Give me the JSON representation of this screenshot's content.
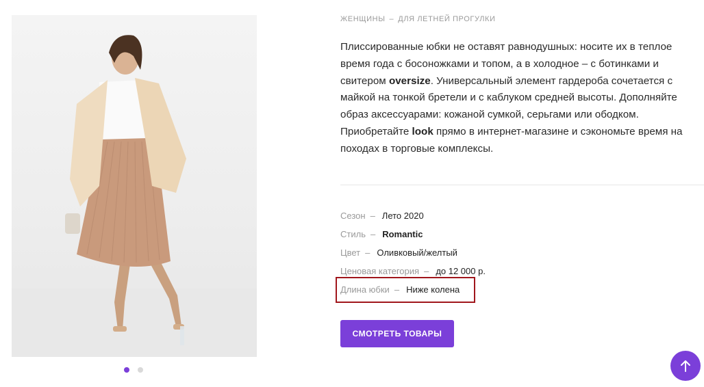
{
  "breadcrumb": {
    "items": [
      "ЖЕНЩИНЫ",
      "ДЛЯ ЛЕТНЕЙ ПРОГУЛКИ"
    ],
    "separator": "–"
  },
  "description": {
    "p1": "Плиссированные юбки не оставят равнодушных: носите их в теплое время года с босоножками и топом, а в холодное – с ботинками и свитером ",
    "b1": "oversize",
    "p2": ". Универсальный элемент гардероба сочетается с майкой на тонкой бретели и с каблуком средней высоты. Дополняйте образ аксессуарами: кожаной сумкой, серьгами или ободком. Приобретайте ",
    "b2": "look",
    "p3": " прямо в интернет-магазине и сэкономьте время на походах в торговые комплексы."
  },
  "attributes": [
    {
      "label": "Сезон",
      "value": "Лето 2020"
    },
    {
      "label": "Стиль",
      "value": "Romantic"
    },
    {
      "label": "Цвет",
      "value": "Оливковый/желтый"
    },
    {
      "label": "Ценовая категория",
      "value": "до 12 000 р."
    },
    {
      "label": "Длина юбки",
      "value": "Ниже колена"
    }
  ],
  "dash": "–",
  "cta": {
    "label": "СМОТРЕТЬ ТОВАРЫ"
  },
  "gallery": {
    "slides": 2,
    "active_index": 0
  },
  "colors": {
    "accent": "#7b3fd9",
    "highlight": "#a0151b"
  },
  "icons": {
    "scroll_top": "arrow-up-icon"
  }
}
